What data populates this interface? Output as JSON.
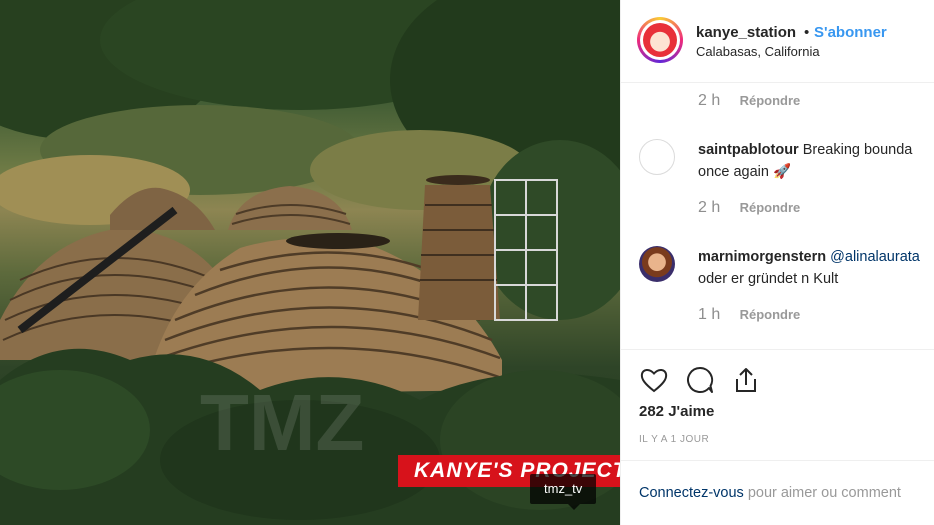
{
  "post": {
    "username": "kanye_station",
    "separator": "•",
    "follow_label": "S'abonner",
    "location": "Calabasas, California",
    "photo_tag": "KANYE'S PROJECT",
    "photo_credit": "tmz_tv"
  },
  "comments": [
    {
      "time": "2 h",
      "reply": "Répondre"
    },
    {
      "user": "saintpablotour",
      "text": "Breaking bounda",
      "text2": "once again 🚀",
      "time": "2 h",
      "reply": "Répondre"
    },
    {
      "user": "marnimorgenstern",
      "mention": "@alinalaurata",
      "text2": "oder er gründet n Kult",
      "time": "1 h",
      "reply": "Répondre"
    }
  ],
  "actions": {
    "icons": [
      "heart-icon",
      "comment-icon",
      "share-icon"
    ],
    "likes": "282 J'aime",
    "timestamp": "IL Y A 1 JOUR"
  },
  "footer": {
    "login_label": "Connectez-vous",
    "rest": "pour aimer ou comment"
  },
  "colors": {
    "link": "#3897f0",
    "tag_red": "#d7121b",
    "text": "#262626",
    "muted": "#999999"
  }
}
